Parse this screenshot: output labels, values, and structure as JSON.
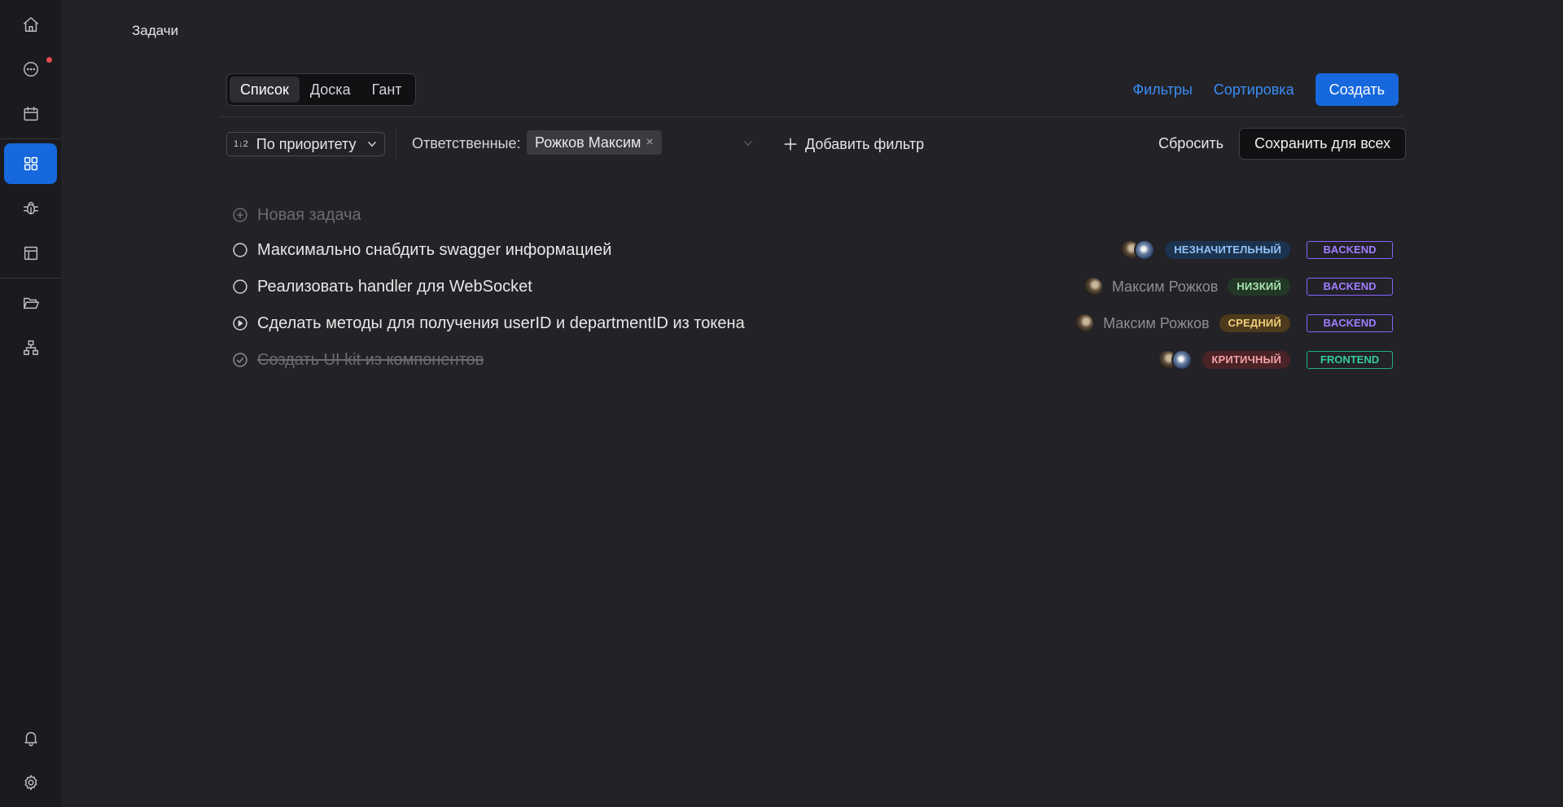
{
  "page": {
    "title": "Задачи"
  },
  "sidebar": {
    "items": [
      {
        "name": "home",
        "icon": "home-icon"
      },
      {
        "name": "messages",
        "icon": "chat-icon",
        "has_notification": true
      },
      {
        "name": "calendar",
        "icon": "calendar-icon"
      },
      {
        "name": "tasks",
        "icon": "grid-icon",
        "active": true
      },
      {
        "name": "bugs",
        "icon": "bug-icon"
      },
      {
        "name": "layout",
        "icon": "layout-icon"
      },
      {
        "name": "files",
        "icon": "folder-open-icon"
      },
      {
        "name": "structure",
        "icon": "org-chart-icon"
      }
    ],
    "bottom": [
      {
        "name": "notifications",
        "icon": "bell-icon"
      },
      {
        "name": "settings",
        "icon": "gear-icon"
      }
    ]
  },
  "view_tabs": [
    {
      "label": "Список",
      "active": true
    },
    {
      "label": "Доска",
      "active": false
    },
    {
      "label": "Гант",
      "active": false
    }
  ],
  "toolbar": {
    "filters_label": "Фильтры",
    "sort_label": "Сортировка",
    "create_label": "Создать"
  },
  "filter_bar": {
    "sort_icon_text": "1↓2",
    "sort_value": "По приоритету",
    "assignees_label": "Ответственные:",
    "assignee_tag": "Рожков Максим",
    "remove_symbol": "×",
    "add_filter_label": "Добавить фильтр",
    "reset_label": "Сбросить",
    "save_all_label": "Сохранить для всех"
  },
  "tasks": {
    "new_placeholder": "Новая задача",
    "items": [
      {
        "title": "Максимально снабдить swagger информацией",
        "status": "open",
        "assignee_name": "",
        "avatars": 2,
        "priority": "НЕЗНАЧИТЕЛЬНЫЙ",
        "label": "BACKEND"
      },
      {
        "title": "Реализовать handler для WebSocket",
        "status": "open",
        "assignee_name": "Максим Рожков",
        "avatars": 1,
        "priority": "НИЗКИЙ",
        "label": "BACKEND"
      },
      {
        "title": "Сделать методы для получения userID и departmentID из токена",
        "status": "in-progress",
        "assignee_name": "Максим Рожков",
        "avatars": 1,
        "priority": "СРЕДНИЙ",
        "label": "BACKEND"
      },
      {
        "title": "Создать UI kit из компонентов",
        "status": "done",
        "assignee_name": "",
        "avatars": 2,
        "priority": "КРИТИЧНЫЙ",
        "label": "FRONTEND"
      }
    ]
  },
  "colors": {
    "accent": "#1668dc",
    "link": "#3b8df5",
    "background": "#222227",
    "sidebar": "#1b1b1f",
    "backend_label": "#8a63ff",
    "frontend_label": "#20b38a",
    "notification_dot": "#e5484d"
  }
}
